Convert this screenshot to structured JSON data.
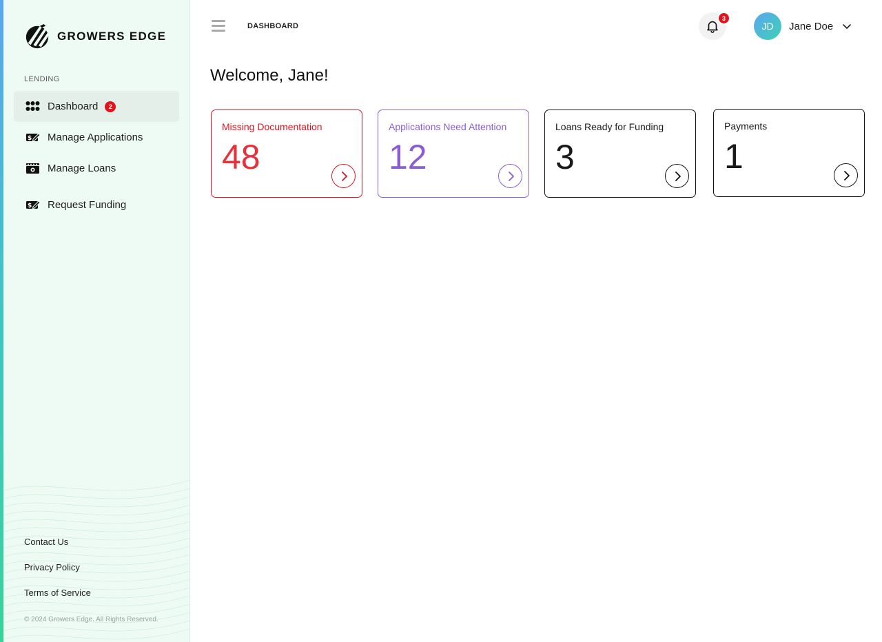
{
  "brand": {
    "name": "GROWERS EDGE",
    "accent_color": "#3ec6c1",
    "sidebar_bg": "#eefbf4"
  },
  "sidebar": {
    "section_label": "LENDING",
    "items": [
      {
        "label": "Dashboard",
        "icon": "grid-icon",
        "badge": "2",
        "active": true
      },
      {
        "label": "Manage Applications",
        "icon": "money-edit-icon",
        "active": false
      },
      {
        "label": "Manage Loans",
        "icon": "cash-stack-icon",
        "active": false
      },
      {
        "label": "Request Funding",
        "icon": "money-edit-icon",
        "active": false
      }
    ],
    "footer_links": [
      "Contact Us",
      "Privacy Policy",
      "Terms of Service"
    ],
    "copyright": "© 2024 Growers Edge. All Rights Reserved."
  },
  "header": {
    "breadcrumb": "DASHBOARD",
    "notifications_count": "3",
    "user": {
      "initials": "JD",
      "name": "Jane Doe"
    }
  },
  "main": {
    "welcome": "Welcome, Jane!",
    "cards": [
      {
        "title": "Missing Documentation",
        "value": "48",
        "color": "#e1141e"
      },
      {
        "title": "Applications Need Attention",
        "value": "12",
        "color": "#8a5cd6"
      },
      {
        "title": "Loans Ready for Funding",
        "value": "3",
        "color": "#111111"
      },
      {
        "title": "Payments",
        "value": "1",
        "color": "#111111"
      }
    ]
  }
}
